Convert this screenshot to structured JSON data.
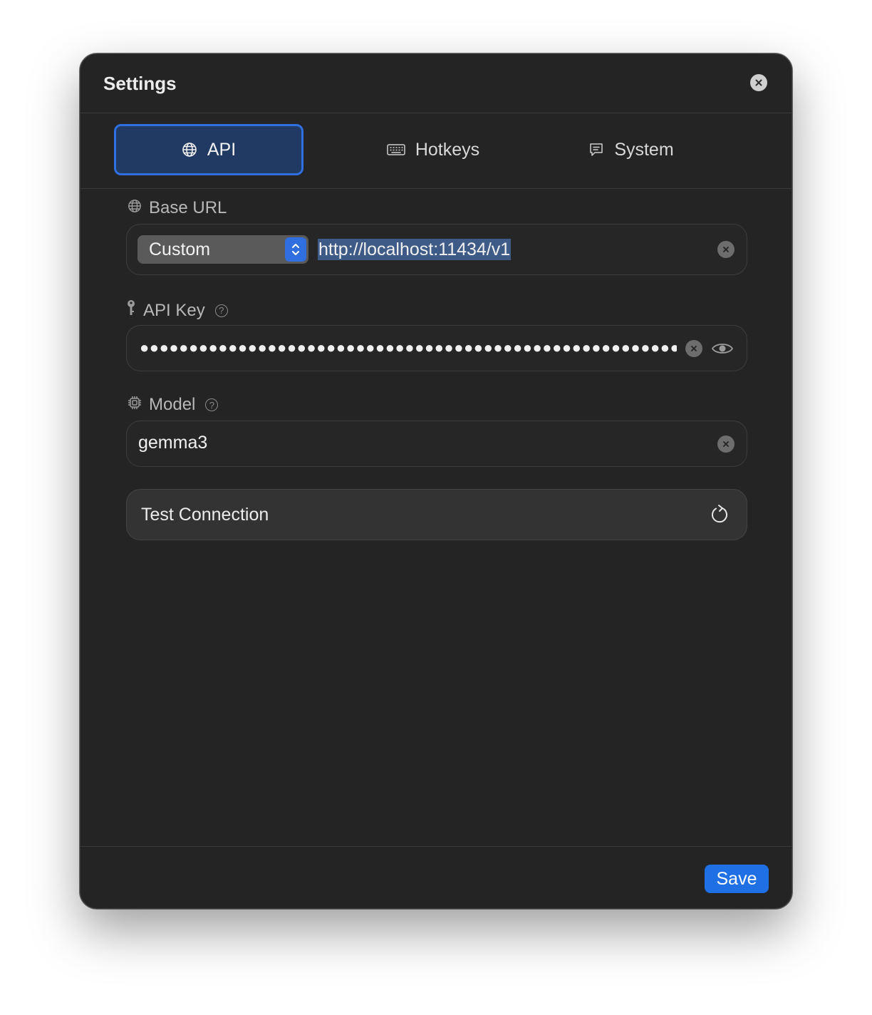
{
  "window": {
    "title": "Settings"
  },
  "tabs": [
    {
      "label": "API",
      "icon": "globe-icon",
      "active": true
    },
    {
      "label": "Hotkeys",
      "icon": "keyboard-icon",
      "active": false
    },
    {
      "label": "System",
      "icon": "chat-bubble-icon",
      "active": false
    }
  ],
  "base_url": {
    "label": "Base URL",
    "provider_selected": "Custom",
    "value": "http://localhost:11434/v1"
  },
  "api_key": {
    "label": "API Key",
    "masked_value": "●●●●●●●●●●●●●●●●●●●●●●●●●●●●●●●●●●●●●●●●●●●●●●●●●●●●●●●"
  },
  "model": {
    "label": "Model",
    "value": "gemma3"
  },
  "test_connection": {
    "label": "Test Connection"
  },
  "footer": {
    "save_label": "Save"
  },
  "colors": {
    "accent": "#2f6fe0",
    "window_bg": "#242424",
    "selection": "#3e5a86"
  }
}
